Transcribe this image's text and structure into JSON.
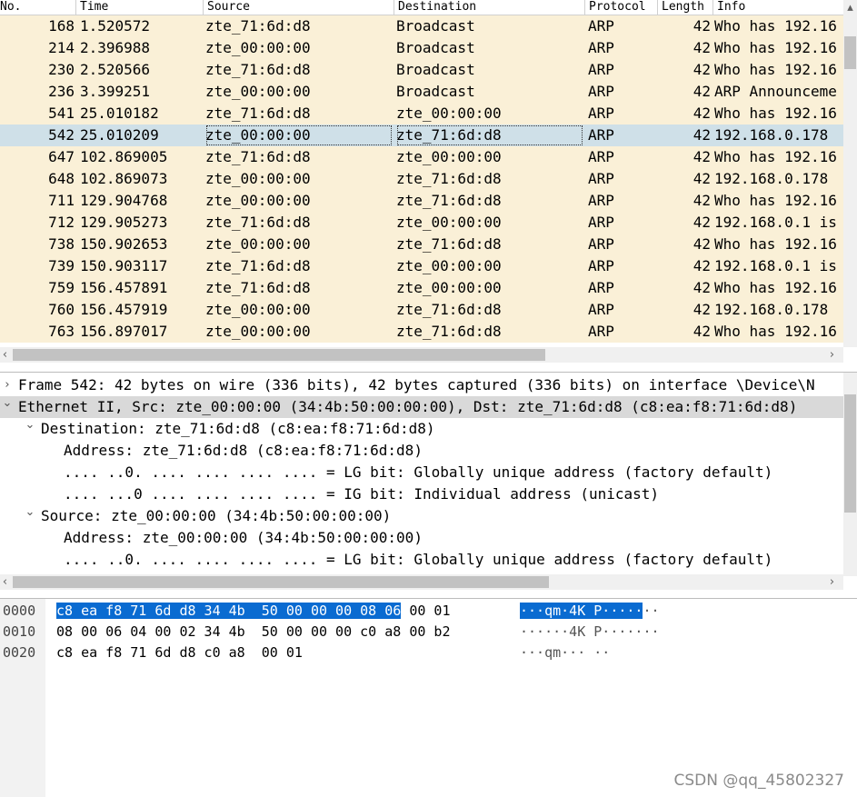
{
  "packet_list": {
    "columns": [
      "No.",
      "Time",
      "Source",
      "Destination",
      "Protocol",
      "Length",
      "Info"
    ],
    "rows": [
      {
        "no": "168",
        "time": "1.520572",
        "source": "zte_71:6d:d8",
        "destination": "Broadcast",
        "protocol": "ARP",
        "length": "42",
        "info": "Who has 192.16"
      },
      {
        "no": "214",
        "time": "2.396988",
        "source": "zte_00:00:00",
        "destination": "Broadcast",
        "protocol": "ARP",
        "length": "42",
        "info": "Who has 192.16"
      },
      {
        "no": "230",
        "time": "2.520566",
        "source": "zte_71:6d:d8",
        "destination": "Broadcast",
        "protocol": "ARP",
        "length": "42",
        "info": "Who has 192.16"
      },
      {
        "no": "236",
        "time": "3.399251",
        "source": "zte_00:00:00",
        "destination": "Broadcast",
        "protocol": "ARP",
        "length": "42",
        "info": "ARP Announceme"
      },
      {
        "no": "541",
        "time": "25.010182",
        "source": "zte_71:6d:d8",
        "destination": "zte_00:00:00",
        "protocol": "ARP",
        "length": "42",
        "info": "Who has 192.16"
      },
      {
        "no": "542",
        "time": "25.010209",
        "source": "zte_00:00:00",
        "destination": "zte_71:6d:d8",
        "protocol": "ARP",
        "length": "42",
        "info": "192.168.0.178"
      },
      {
        "no": "647",
        "time": "102.869005",
        "source": "zte_71:6d:d8",
        "destination": "zte_00:00:00",
        "protocol": "ARP",
        "length": "42",
        "info": "Who has 192.16"
      },
      {
        "no": "648",
        "time": "102.869073",
        "source": "zte_00:00:00",
        "destination": "zte_71:6d:d8",
        "protocol": "ARP",
        "length": "42",
        "info": "192.168.0.178"
      },
      {
        "no": "711",
        "time": "129.904768",
        "source": "zte_00:00:00",
        "destination": "zte_71:6d:d8",
        "protocol": "ARP",
        "length": "42",
        "info": "Who has 192.16"
      },
      {
        "no": "712",
        "time": "129.905273",
        "source": "zte_71:6d:d8",
        "destination": "zte_00:00:00",
        "protocol": "ARP",
        "length": "42",
        "info": "192.168.0.1 is"
      },
      {
        "no": "738",
        "time": "150.902653",
        "source": "zte_00:00:00",
        "destination": "zte_71:6d:d8",
        "protocol": "ARP",
        "length": "42",
        "info": "Who has 192.16"
      },
      {
        "no": "739",
        "time": "150.903117",
        "source": "zte_71:6d:d8",
        "destination": "zte_00:00:00",
        "protocol": "ARP",
        "length": "42",
        "info": "192.168.0.1 is"
      },
      {
        "no": "759",
        "time": "156.457891",
        "source": "zte_71:6d:d8",
        "destination": "zte_00:00:00",
        "protocol": "ARP",
        "length": "42",
        "info": "Who has 192.16"
      },
      {
        "no": "760",
        "time": "156.457919",
        "source": "zte_00:00:00",
        "destination": "zte_71:6d:d8",
        "protocol": "ARP",
        "length": "42",
        "info": "192.168.0.178"
      },
      {
        "no": "763",
        "time": "156.897017",
        "source": "zte_00:00:00",
        "destination": "zte_71:6d:d8",
        "protocol": "ARP",
        "length": "42",
        "info": "Who has 192.16"
      }
    ],
    "selected_row": "542"
  },
  "details": {
    "lines": [
      {
        "chevron": "right-icon",
        "text": "Frame 542: 42 bytes on wire (336 bits), 42 bytes captured (336 bits) on interface \\Device\\N",
        "selected": false
      },
      {
        "chevron": "down-icon",
        "text": "Ethernet II, Src: zte_00:00:00 (34:4b:50:00:00:00), Dst: zte_71:6d:d8 (c8:ea:f8:71:6d:d8)",
        "selected": true
      },
      {
        "chevron": "down-icon",
        "text": "Destination: zte_71:6d:d8 (c8:ea:f8:71:6d:d8)",
        "selected": false
      },
      {
        "chevron": "",
        "text": "Address: zte_71:6d:d8 (c8:ea:f8:71:6d:d8)",
        "selected": false
      },
      {
        "chevron": "",
        "text": ".... ..0. .... .... .... .... = LG bit: Globally unique address (factory default)",
        "selected": false
      },
      {
        "chevron": "",
        "text": ".... ...0 .... .... .... .... = IG bit: Individual address (unicast)",
        "selected": false
      },
      {
        "chevron": "down-icon",
        "text": "Source: zte_00:00:00 (34:4b:50:00:00:00)",
        "selected": false
      },
      {
        "chevron": "",
        "text": "Address: zte_00:00:00 (34:4b:50:00:00:00)",
        "selected": false
      },
      {
        "chevron": "",
        "text": ".... ..0. .... .... .... .... = LG bit: Globally unique address (factory default)",
        "selected": false
      }
    ]
  },
  "bytes": {
    "lines": [
      {
        "offset": "0000",
        "hex_selected": "c8 ea f8 71 6d d8 34 4b  50 00 00 00 08 06",
        "hex_rest": " 00 01",
        "ascii_selected": "···qm·4K P·····",
        "ascii_rest": "··"
      },
      {
        "offset": "0010",
        "hex_selected": "",
        "hex_rest": "08 00 06 04 00 02 34 4b  50 00 00 00 c0 a8 00 b2",
        "ascii_selected": "",
        "ascii_rest": "······4K P·······"
      },
      {
        "offset": "0020",
        "hex_selected": "",
        "hex_rest": "c8 ea f8 71 6d d8 c0 a8  00 01",
        "ascii_selected": "",
        "ascii_rest": "···qm··· ··"
      }
    ]
  },
  "watermark": "CSDN @qq_45802327",
  "colors": {
    "row_background": "#faf0d7",
    "row_selected": "#cfe0e8",
    "detail_selected": "#d9d9d9",
    "bytes_highlight": "#0a6bd1"
  }
}
